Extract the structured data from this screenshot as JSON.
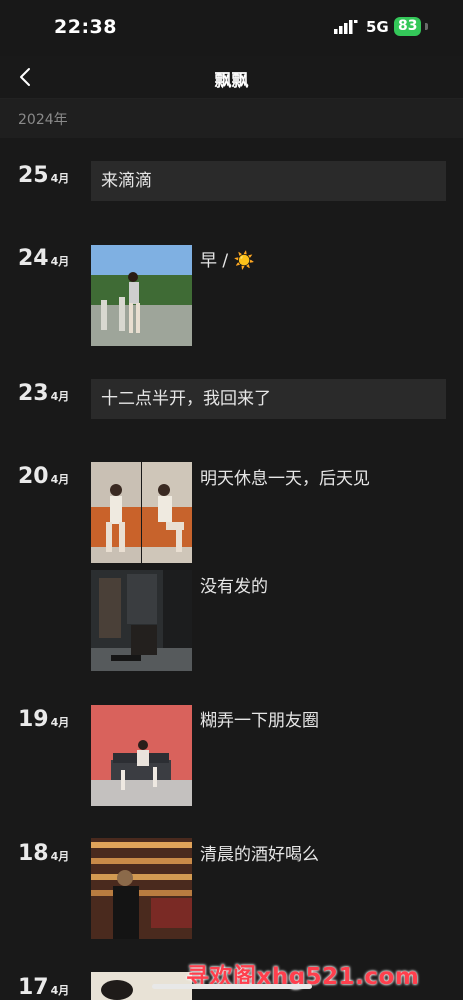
{
  "status_bar": {
    "time": "22:38",
    "network": "5G",
    "battery": "83"
  },
  "nav": {
    "title": "飘飘"
  },
  "year_label": "2024年",
  "posts": [
    {
      "day": "25",
      "month": "4月",
      "text": "来滴滴"
    },
    {
      "day": "24",
      "month": "4月",
      "caption": "早 / ☀️"
    },
    {
      "day": "23",
      "month": "4月",
      "text": "十二点半开，我回来了"
    },
    {
      "day": "20",
      "month": "4月",
      "caption": "明天休息一天，后天见",
      "caption2": "没有发的"
    },
    {
      "day": "19",
      "month": "4月",
      "caption": "糊弄一下朋友圈"
    },
    {
      "day": "18",
      "month": "4月",
      "caption": "清晨的酒好喝么"
    },
    {
      "day": "17",
      "month": "4月"
    }
  ],
  "watermark": "寻欢阁xhg521.com",
  "colors": {
    "background": "#191919",
    "battery": "#34c759",
    "watermark": "#ff3f4d"
  }
}
